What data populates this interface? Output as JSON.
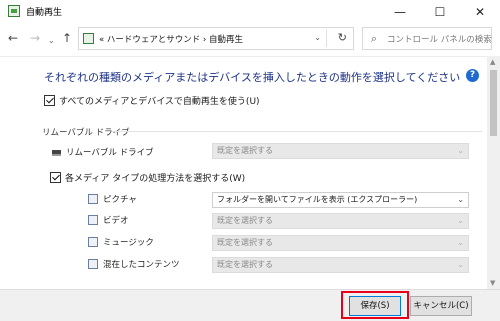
{
  "window": {
    "title": "自動再生",
    "controls": {
      "minimize": "—",
      "maximize": "☐",
      "close": "✕"
    }
  },
  "nav": {
    "back": "←",
    "forward": "→",
    "dropdown": "⌄",
    "up": "↑",
    "address": "«  ハードウェアとサウンド  ›  自動再生",
    "address_dropdown": "⌄",
    "refresh": "↻",
    "search_icon": "⌕",
    "search_placeholder": "コントロール パネルの検索"
  },
  "main": {
    "heading": "それぞれの種類のメディアまたはデバイスを挿入したときの動作を選択してください",
    "help": "?",
    "use_autoplay_label": "すべてのメディアとデバイスで自動再生を使う(U)",
    "use_autoplay_checked": true,
    "removable_section": "リムーバブル ドライブ",
    "removable": {
      "label": "リムーバブル ドライブ",
      "value": "既定を選択する",
      "disabled": true
    },
    "choose_each_label": "各メディア タイプの処理方法を選択する(W)",
    "choose_each_checked": true,
    "media_types": [
      {
        "icon": "picture-icon",
        "label": "ピクチャ",
        "value": "フォルダーを開いてファイルを表示 (エクスプローラー)",
        "disabled": false
      },
      {
        "icon": "video-icon",
        "label": "ビデオ",
        "value": "既定を選択する",
        "disabled": true
      },
      {
        "icon": "music-icon",
        "label": "ミュージック",
        "value": "既定を選択する",
        "disabled": true
      },
      {
        "icon": "mixed-content-icon",
        "label": "混在したコンテンツ",
        "value": "既定を選択する",
        "disabled": true
      }
    ]
  },
  "footer": {
    "save": "保存(S)",
    "cancel": "キャンセル(C)"
  },
  "colors": {
    "heading": "#1e3287",
    "highlight": "#e8001a",
    "help": "#1e6ad1"
  }
}
